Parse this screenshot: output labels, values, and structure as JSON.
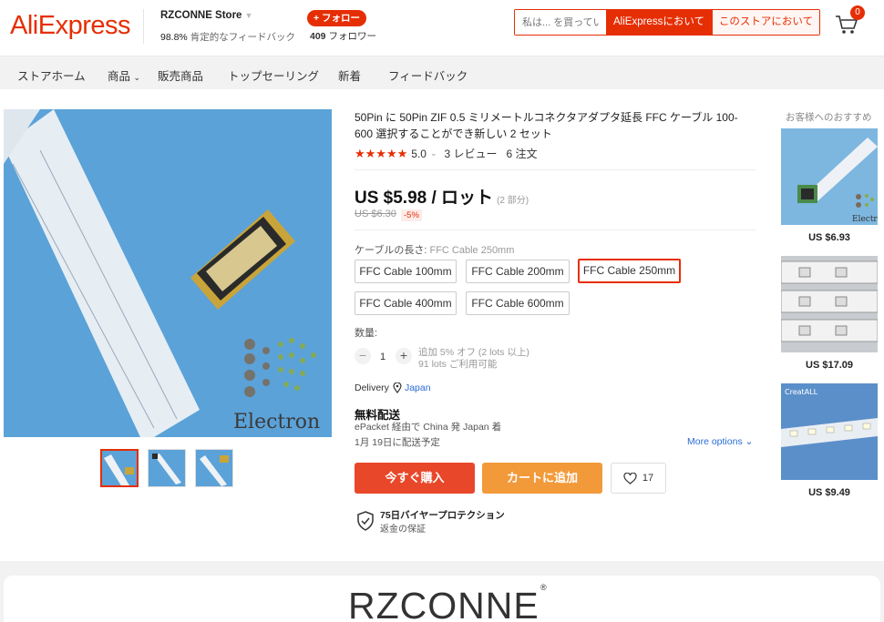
{
  "header": {
    "logo": "AliExpress",
    "store_name": "RZCONNE Store",
    "store_feedback_pct": "98.8%",
    "store_feedback_label": "肯定的なフィードバック",
    "follow_label": "+ フォロー",
    "followers_count": "409",
    "followers_label": "フォロワー",
    "search_placeholder": "私は... を買ってい",
    "search_ae_label": "AliExpressにおいて",
    "search_store_label": "このストアにおいて",
    "cart_count": "0"
  },
  "nav": {
    "items": [
      "ストアホーム",
      "商品",
      "販売商品",
      "トップセーリング",
      "新着",
      "フィードバック"
    ]
  },
  "product": {
    "title": "50Pin に 50Pin ZIF 0.5 ミリメートルコネクタアダプタ延長 FFC ケーブル 100-600 選択することができ新しい 2 セット",
    "rating_value": "5.0",
    "reviews": "3 レビュー",
    "orders": "6 注文",
    "price": "US $5.98 / ロット",
    "price_sub": "(2 部分)",
    "old_price": "US $6.30",
    "discount": "-5%",
    "prop_label": "ケーブルの長さ:",
    "prop_selected": "FFC Cable 250mm",
    "options": [
      "FFC Cable 100mm",
      "FFC Cable 200mm",
      "FFC Cable 250mm",
      "FFC Cable 400mm",
      "FFC Cable 600mm"
    ],
    "qty_label": "数量:",
    "qty_value": "1",
    "qty_note1": "追加 5% オフ (2 lots 以上)",
    "qty_note2": "91 lots ご利用可能",
    "delivery_label": "Delivery",
    "delivery_loc": "Japan",
    "shipping_title": "無料配送",
    "shipping_via": "ePacket 経由で China 発 Japan 着",
    "shipping_date": "1月 19日に配送予定",
    "more_options": "More options",
    "buy_now": "今すぐ購入",
    "add_cart": "カートに追加",
    "wish_count": "17",
    "protect_title": "75日バイヤープロテクション",
    "protect_sub": "返金の保証",
    "image_watermark": "Electron"
  },
  "recommend": {
    "title": "お客様へのおすすめ",
    "items": [
      {
        "price": "US $6.93",
        "watermark": "Electron"
      },
      {
        "price": "US $17.09"
      },
      {
        "price": "US $9.49",
        "watermark": "CreatALL"
      }
    ]
  },
  "banner": {
    "text": "RZCONNE",
    "reg": "®"
  },
  "colors": {
    "accent": "#e62e04",
    "buy": "#e8472a",
    "cart": "#f29a3a",
    "link": "#2a6bd8"
  }
}
